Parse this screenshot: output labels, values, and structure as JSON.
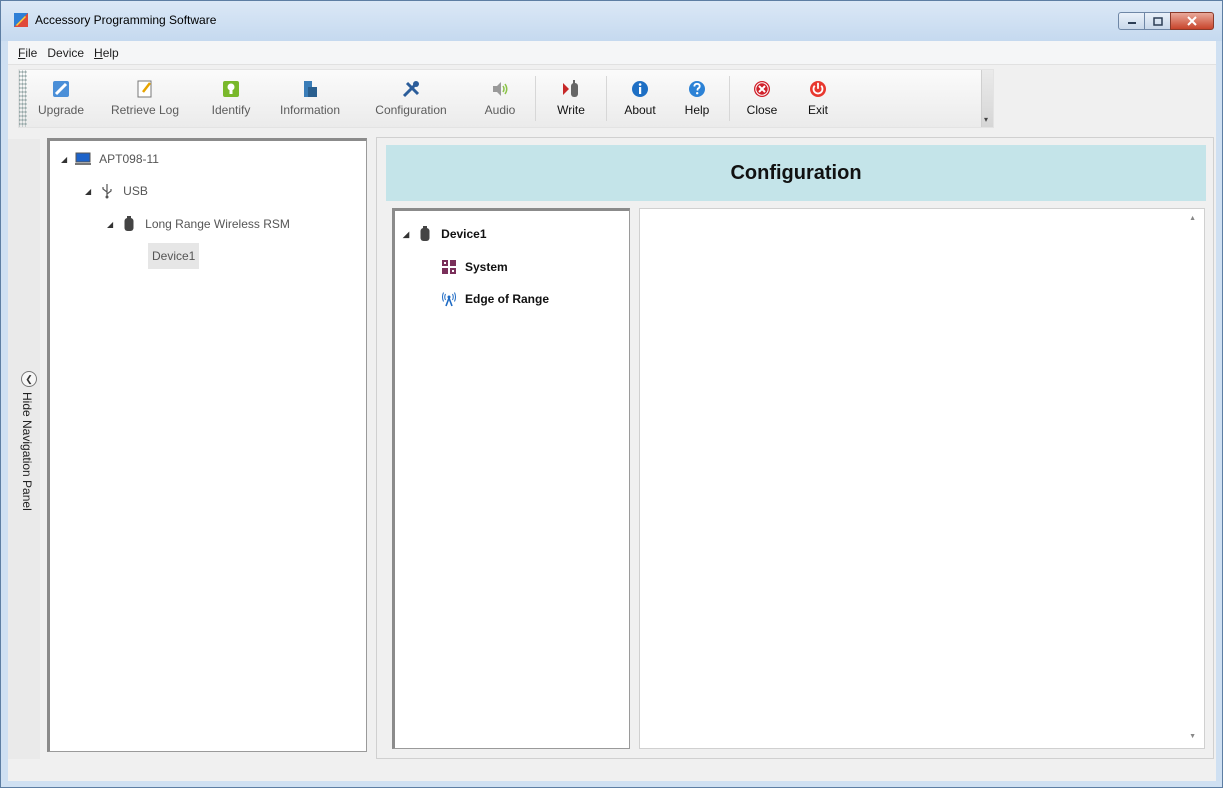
{
  "window": {
    "title": "Accessory Programming Software",
    "controls": {
      "minimize": "minimize",
      "maximize": "maximize",
      "close": "close"
    }
  },
  "menu": {
    "items": [
      {
        "label": "File",
        "mnemonic": "F",
        "rest": "ile"
      },
      {
        "label": "Device",
        "mnemonic": "",
        "rest": "Device"
      },
      {
        "label": "Help",
        "mnemonic": "H",
        "rest": "elp"
      }
    ]
  },
  "toolbar": {
    "buttons": [
      {
        "label": "Upgrade",
        "icon": "upgrade-icon",
        "enabled": false
      },
      {
        "label": "Retrieve Log",
        "icon": "retrieve-log-icon",
        "enabled": false
      },
      {
        "label": "Identify",
        "icon": "identify-icon",
        "enabled": false
      },
      {
        "label": "Information",
        "icon": "information-icon",
        "enabled": false
      },
      {
        "label": "Configuration",
        "icon": "configuration-icon",
        "enabled": false
      },
      {
        "label": "Audio",
        "icon": "audio-icon",
        "enabled": false
      },
      {
        "label": "Write",
        "icon": "write-icon",
        "enabled": true
      },
      {
        "label": "About",
        "icon": "about-icon",
        "enabled": true
      },
      {
        "label": "Help",
        "icon": "help-icon",
        "enabled": true
      },
      {
        "label": "Close",
        "icon": "close-icon",
        "enabled": true
      },
      {
        "label": "Exit",
        "icon": "exit-icon",
        "enabled": true
      }
    ]
  },
  "nav_panel": {
    "toggle_label": "Hide Navigation Panel",
    "tree": {
      "computer": "APT098-11",
      "usb": "USB",
      "device_type": "Long Range Wireless RSM",
      "device": "Device1"
    }
  },
  "content": {
    "header": "Configuration",
    "tree": {
      "device": "Device1",
      "items": [
        "System",
        "Edge of Range"
      ]
    }
  },
  "colors": {
    "header_bg": "#c4e4e9",
    "window_frame": "#cfe0f2"
  }
}
